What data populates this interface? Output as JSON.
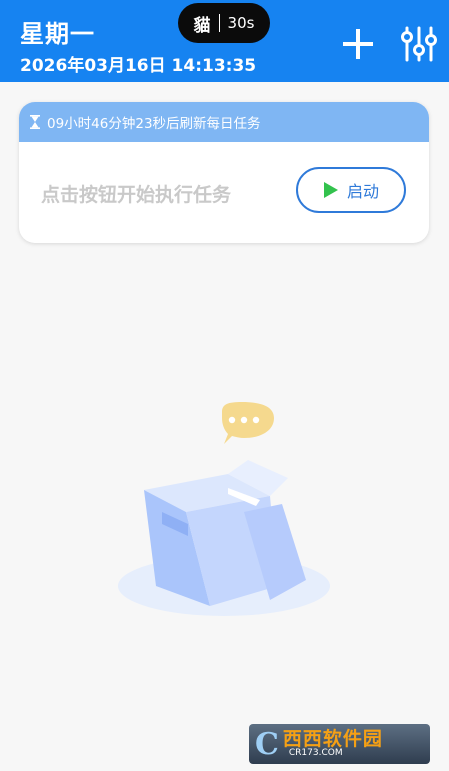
{
  "header": {
    "weekday": "星期一",
    "datetime": "2026年03月16日 14:13:35",
    "timer_glyph": "貓",
    "timer_label": "30s",
    "background_color": "#1683f1"
  },
  "icons": {
    "add": "plus-icon",
    "settings": "sliders-icon",
    "hourglass": "hourglass-icon",
    "play": "play-icon"
  },
  "task_card": {
    "refresh_notice": "09小时46分钟23秒后刷新每日任务",
    "hint": "点击按钮开始执行任务",
    "start_label": "启动"
  },
  "watermark": {
    "logo_glyph": "C",
    "brand": "西西软件园",
    "domain": "CR173.COM"
  }
}
